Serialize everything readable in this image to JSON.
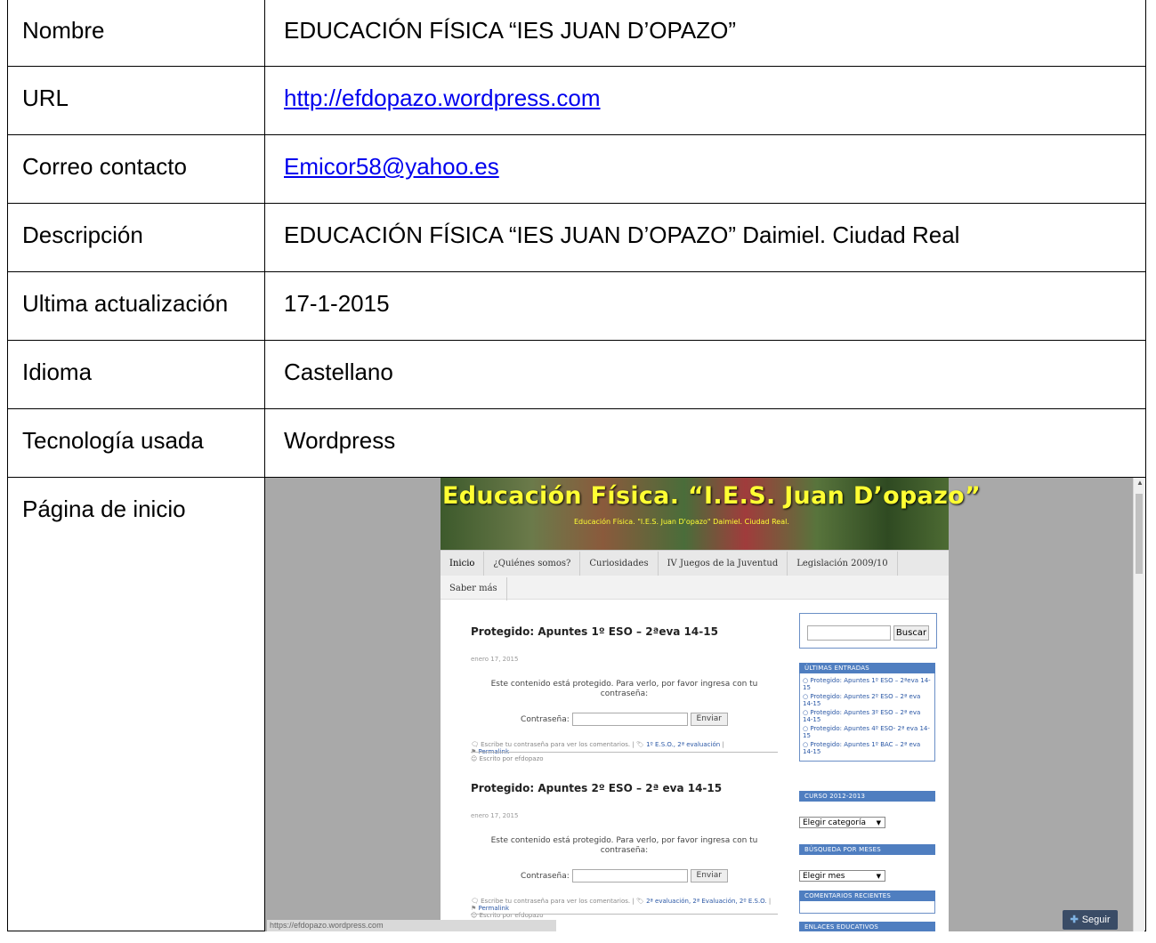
{
  "rows": [
    {
      "label": "Nombre",
      "value": "EDUCACIÓN FÍSICA “IES JUAN D’OPAZO”"
    },
    {
      "label": "URL",
      "value": "http://efdopazo.wordpress.com"
    },
    {
      "label": "Correo contacto",
      "value": "Emicor58@yahoo.es"
    },
    {
      "label": "Descripción",
      "value": "EDUCACIÓN FÍSICA “IES JUAN D’OPAZO” Daimiel. Ciudad Real"
    },
    {
      "label": "Ultima actualización",
      "value": "17-1-2015"
    },
    {
      "label": "Idioma",
      "value": "Castellano"
    },
    {
      "label": "Tecnología usada",
      "value": "Wordpress"
    },
    {
      "label": "Página de inicio"
    }
  ],
  "screenshot": {
    "header_title": "Educación Física. “I.E.S. Juan D’opazo”",
    "header_subtitle": "Educación Física. \"I.E.S. Juan D'opazo\" Daimiel. Ciudad Real.",
    "nav": [
      "Inicio",
      "¿Quiénes somos?",
      "Curiosidades",
      "IV Juegos de la Juventud",
      "Legislación 2009/10"
    ],
    "nav2": [
      "Saber más"
    ],
    "posts": [
      {
        "title": "Protegido: Apuntes 1º ESO – 2ªeva 14-15",
        "date": "enero 17, 2015",
        "protected_text": "Este contenido está protegido. Para verlo, por favor ingresa con tu contraseña:",
        "password_label": "Contraseña:",
        "button": "Enviar",
        "meta_comments": "Escribe tu contraseña para ver los comentarios. |",
        "meta_category": "1º E.S.O., 2ª evaluación",
        "meta_permalink": "Permalink",
        "meta_author": "Escrito por efdopazo"
      },
      {
        "title": "Protegido: Apuntes 2º ESO – 2ª eva 14-15",
        "date": "enero 17, 2015",
        "protected_text": "Este contenido está protegido. Para verlo, por favor ingresa con tu contraseña:",
        "password_label": "Contraseña:",
        "button": "Enviar",
        "meta_comments": "Escribe tu contraseña para ver los comentarios. |",
        "meta_category": "2ª evaluación, 2ª Evaluación, 2º E.S.O.",
        "meta_permalink": "Permalink",
        "meta_author": "Escrito por efdopazo"
      }
    ],
    "search_button": "Buscar",
    "widget_latest_title": "ÚLTIMAS ENTRADAS",
    "latest_entries": [
      "Protegido: Apuntes 1º ESO – 2ªeva 14-15",
      "Protegido: Apuntes 2º ESO – 2ª eva 14-15",
      "Protegido: Apuntes 3º ESO – 2ª eva 14-15",
      "Protegido: Apuntes 4º ESO- 2ª eva 14-15",
      "Protegido: Apuntes 1º BAC – 2ª eva 14-15"
    ],
    "widget_course_title": "CURSO 2012-2013",
    "course_select": "Elegir categoría",
    "widget_months_title": "BÚSQUEDA POR MESES",
    "months_select": "Elegir mes",
    "widget_comments_title": "COMENTARIOS RECIENTES",
    "widget_links_title": "ENLACES EDUCATIVOS",
    "status_url": "https://efdopazo.wordpress.com",
    "follow_button": "Seguir"
  }
}
